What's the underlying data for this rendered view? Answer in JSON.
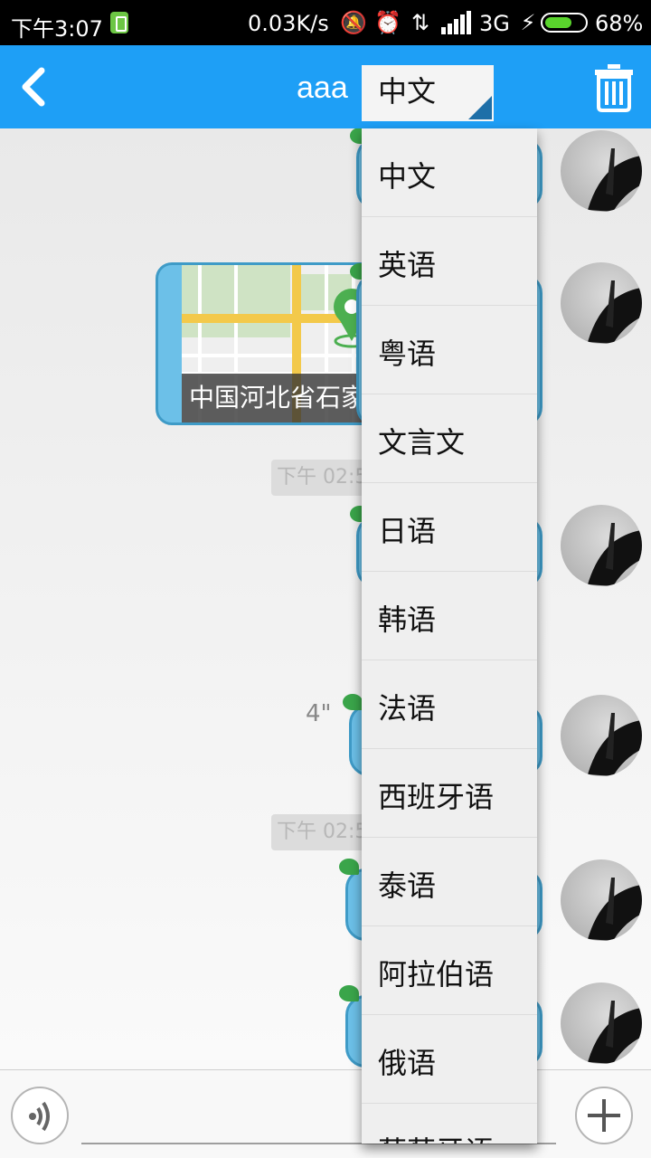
{
  "status_bar": {
    "time": "下午3:07",
    "net_speed": "0.03K/s",
    "network": "3G",
    "battery_percent": "68%",
    "battery_level": 0.68,
    "icons": [
      "battery-saver-icon",
      "mute-icon",
      "alarm-icon",
      "data-transfer-icon",
      "signal-icon",
      "charging-icon",
      "battery-icon"
    ]
  },
  "header": {
    "title": "aaa",
    "back_icon": "chevron-left-icon",
    "delete_icon": "trash-icon",
    "background": "#1e9ff6"
  },
  "language_spinner": {
    "selected": "中文"
  },
  "language_menu": {
    "items": [
      "中文",
      "英语",
      "粤语",
      "文言文",
      "日语",
      "韩语",
      "法语",
      "西班牙语",
      "泰语",
      "阿拉伯语",
      "俄语",
      "葡萄牙语"
    ]
  },
  "chat": {
    "map_message": {
      "caption": "中国河北省石家"
    },
    "timestamps": [
      "下午 02:5",
      "下午 02:5"
    ],
    "voice_duration": "4\""
  },
  "input_bar": {
    "voice_icon": "voice-icon",
    "add_icon": "plus-icon"
  }
}
